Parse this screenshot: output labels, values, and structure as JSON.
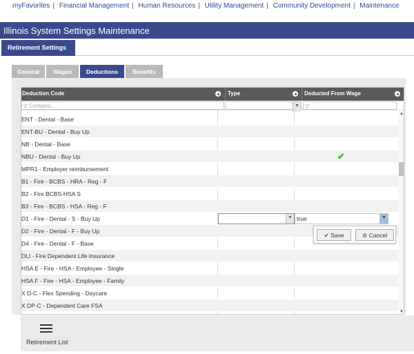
{
  "topnav": [
    "myFavorites",
    "Financial Management",
    "Human Resources",
    "Utility Management",
    "Community Development",
    "Maintenance"
  ],
  "title": "Illinois System Settings Maintenance",
  "subtab": "Retirement Settings",
  "tabs": [
    "General",
    "Wages",
    "Deductions",
    "Benefits"
  ],
  "active_tab": "Deductions",
  "columns": {
    "code": "Deduction Code",
    "type": "Type",
    "deducted": "Deducted From Wage"
  },
  "filter_placeholder": "Contains...",
  "rows": [
    "ENT - Dental - Base",
    "ENT-BU - Dental - Buy Up",
    "NB - Dental - Base",
    "NBU - Dental - Buy Up",
    "MPR1 - Employer reimbursement",
    "B1 - Fire - BCBS - HRA - Reg - F",
    "B2 - Fire BCBS-HSA S",
    "B3 - Fire - BCBS - HSA - Reg - F",
    "D1 - Fire - Dental - S - Buy Up",
    "D2 - Fire - Dental - F - Buy Up",
    "D4 - Fire - Dental - F - Base",
    "DLI - Fire Dependent Life Insurance",
    "HSA E - Fire - HSA - Employee - Single",
    "HSA F - Fire - HSA - Employee - Family",
    "X D-C - Flex Spending - Daycare",
    "X DP-C - Dependent Care FSA"
  ],
  "checked_row_index": 3,
  "edit_row_index": 8,
  "edit_value": "true",
  "save_label": "Save",
  "cancel_label": "Cancel",
  "bottom_label": "Retirement List",
  "colors": {
    "primary": "#3a4a8c",
    "header": "#5a5a5a",
    "check": "#4caf2e"
  }
}
